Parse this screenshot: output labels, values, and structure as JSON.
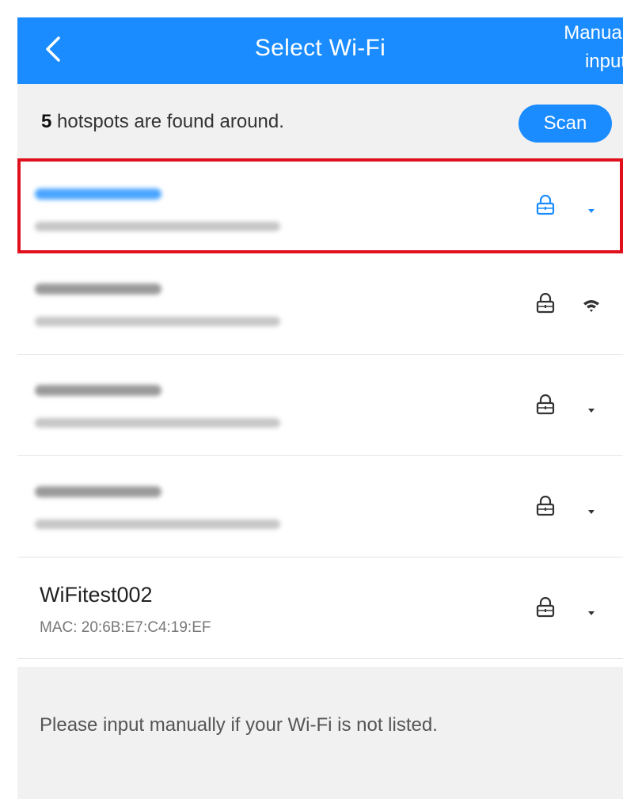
{
  "header": {
    "title": "Select Wi-Fi",
    "manual_input_label": "Manual input",
    "back_icon": "chevron-left-icon",
    "background_color": "#1a8cff"
  },
  "summary": {
    "count": "5",
    "text": " hotspots are found around.",
    "scan_label": "Scan"
  },
  "networks": [
    {
      "name": "",
      "mac": "",
      "blurred": true,
      "selected": true,
      "locked": true,
      "signal_icon": "signal-low-icon",
      "accent": "#1a8cff"
    },
    {
      "name": "",
      "mac": "",
      "blurred": true,
      "selected": false,
      "locked": true,
      "signal_icon": "wifi-signal-icon"
    },
    {
      "name": "",
      "mac": "",
      "blurred": true,
      "selected": false,
      "locked": true,
      "signal_icon": "signal-low-icon"
    },
    {
      "name": "",
      "mac": "",
      "blurred": true,
      "selected": false,
      "locked": true,
      "signal_icon": "signal-low-icon"
    },
    {
      "name": "WiFitest002",
      "mac": "MAC: 20:6B:E7:C4:19:EF",
      "blurred": false,
      "selected": false,
      "locked": true,
      "signal_icon": "signal-low-icon"
    }
  ],
  "footer": {
    "hint": "Please input manually if your Wi-Fi is not listed."
  },
  "colors": {
    "accent": "#1a8cff",
    "selection_border": "#e0101c",
    "icon_gray": "#333333"
  }
}
